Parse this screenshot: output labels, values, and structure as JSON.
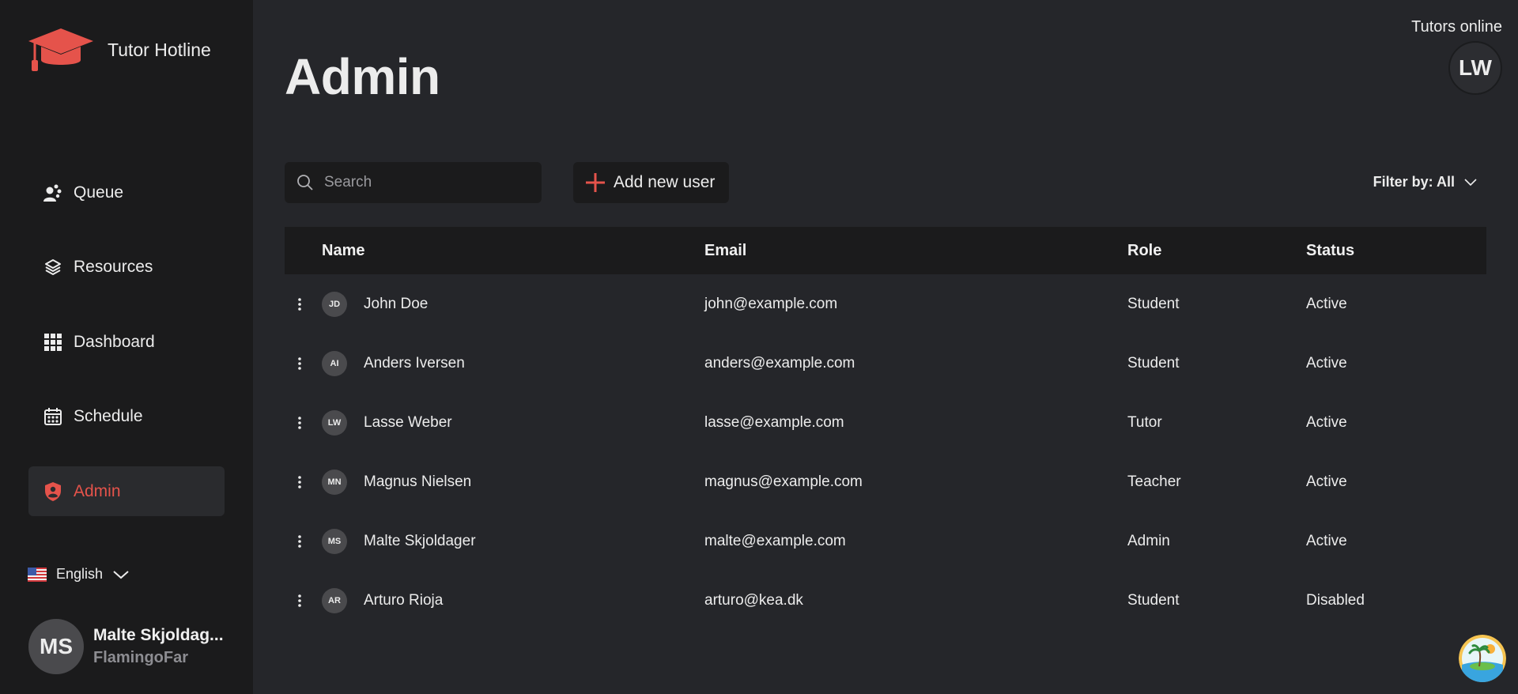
{
  "app": {
    "name": "Tutor Hotline",
    "accent": "#e5534b"
  },
  "nav": [
    {
      "label": "Queue",
      "icon": "queue-icon",
      "active": false
    },
    {
      "label": "Resources",
      "icon": "layers-icon",
      "active": false
    },
    {
      "label": "Dashboard",
      "icon": "grid-icon",
      "active": false
    },
    {
      "label": "Schedule",
      "icon": "calendar-icon",
      "active": false
    },
    {
      "label": "Admin",
      "icon": "shield-user-icon",
      "active": true
    }
  ],
  "language": {
    "label": "English",
    "icon": "us-flag-icon"
  },
  "profile": {
    "initials": "MS",
    "name": "Malte Skjoldag...",
    "username": "FlamingoFar"
  },
  "header": {
    "title": "Admin",
    "tutors_online_label": "Tutors online",
    "tutor_initials": "LW"
  },
  "toolbar": {
    "search_placeholder": "Search",
    "add_user_label": "Add new user",
    "filter_label": "Filter by: All"
  },
  "table": {
    "columns": {
      "name": "Name",
      "email": "Email",
      "role": "Role",
      "status": "Status"
    },
    "rows": [
      {
        "initials": "JD",
        "name": "John Doe",
        "email": "john@example.com",
        "role": "Student",
        "status": "Active"
      },
      {
        "initials": "AI",
        "name": "Anders Iversen",
        "email": "anders@example.com",
        "role": "Student",
        "status": "Active"
      },
      {
        "initials": "LW",
        "name": "Lasse Weber",
        "email": "lasse@example.com",
        "role": "Tutor",
        "status": "Active"
      },
      {
        "initials": "MN",
        "name": "Magnus Nielsen",
        "email": "magnus@example.com",
        "role": "Teacher",
        "status": "Active"
      },
      {
        "initials": "MS",
        "name": "Malte Skjoldager",
        "email": "malte@example.com",
        "role": "Admin",
        "status": "Active"
      },
      {
        "initials": "AR",
        "name": "Arturo Rioja",
        "email": "arturo@kea.dk",
        "role": "Student",
        "status": "Disabled"
      }
    ]
  }
}
